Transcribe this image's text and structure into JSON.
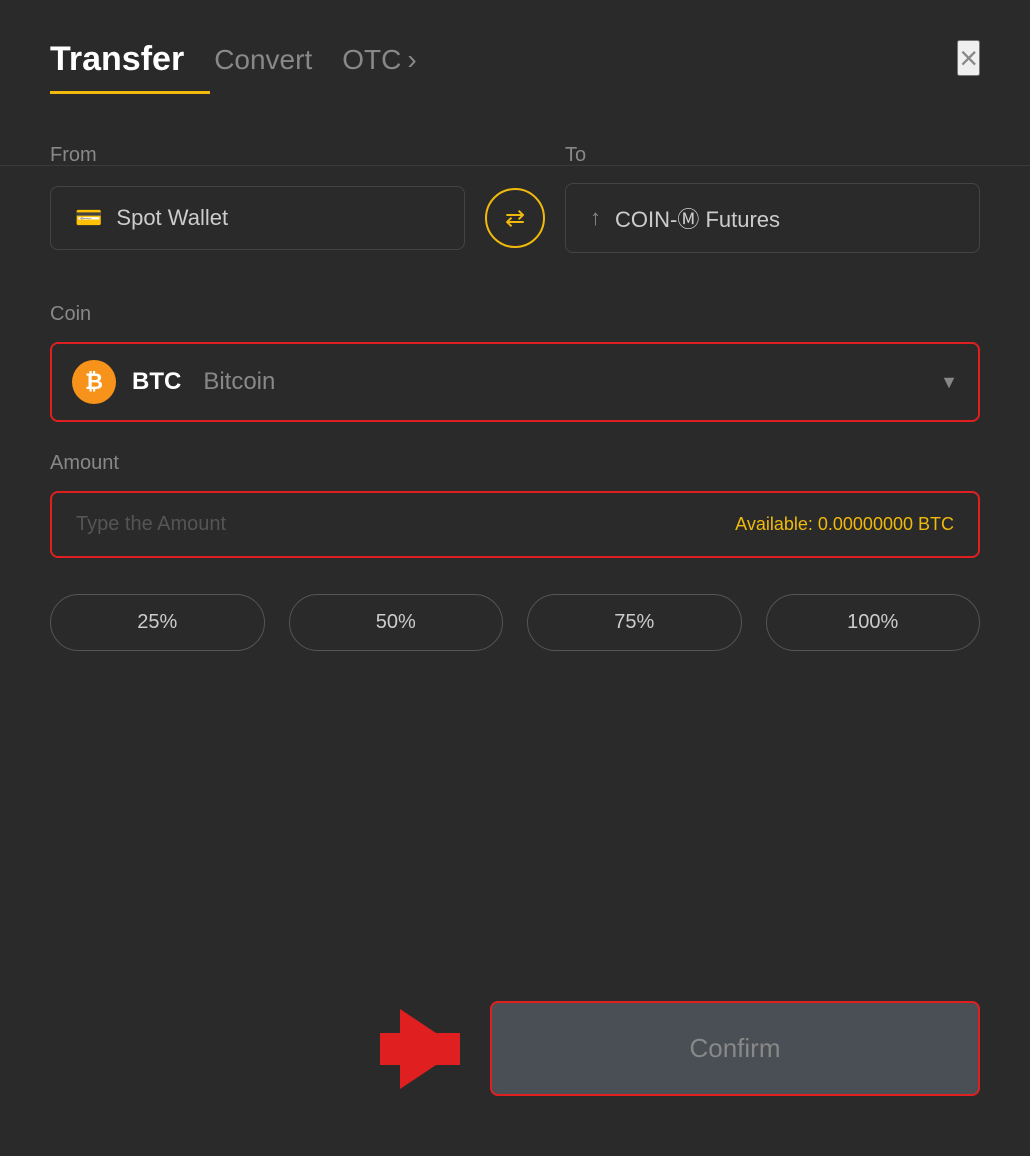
{
  "header": {
    "title": "Transfer",
    "tab_convert": "Convert",
    "tab_otc": "OTC",
    "tab_otc_arrow": "›",
    "close_label": "×"
  },
  "from": {
    "label": "From",
    "wallet_icon": "🪪",
    "wallet_name": "Spot Wallet"
  },
  "to": {
    "label": "To",
    "wallet_icon": "↑",
    "wallet_name": "COIN-Ⓜ Futures"
  },
  "swap": {
    "icon": "⇄"
  },
  "coin": {
    "label": "Coin",
    "symbol": "BTC",
    "name": "Bitcoin",
    "icon_letter": "₿"
  },
  "amount": {
    "label": "Amount",
    "placeholder": "Type the Amount",
    "available_label": "Available:",
    "available_value": "0.00000000 BTC"
  },
  "percent_buttons": [
    "25%",
    "50%",
    "75%",
    "100%"
  ],
  "confirm": {
    "label": "Confirm"
  }
}
